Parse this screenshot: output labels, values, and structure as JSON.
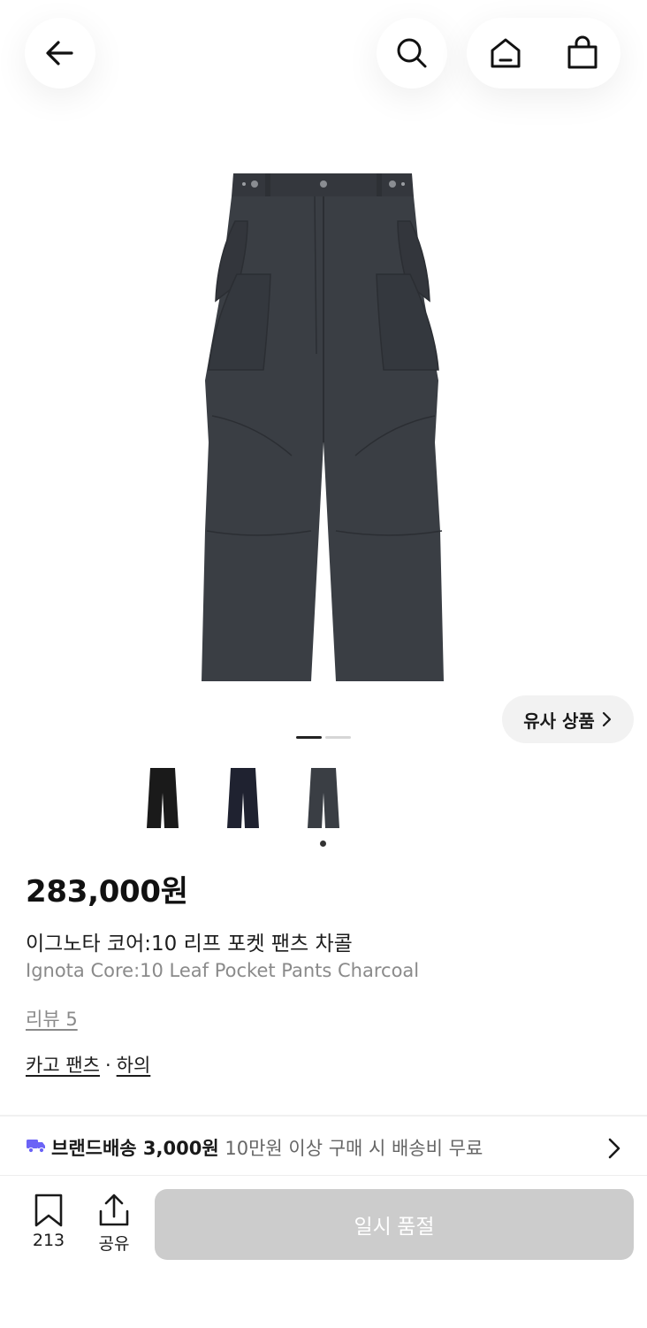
{
  "header": {
    "back_icon": "arrow-left-icon",
    "search_icon": "search-icon",
    "home_icon": "home-icon",
    "cart_icon": "shopping-bag-icon"
  },
  "gallery": {
    "similar_button_label": "유사 상품",
    "image_count": 2,
    "current_image": 1
  },
  "variants": {
    "items": [
      "black",
      "navy",
      "charcoal"
    ],
    "selected_index": 2
  },
  "product": {
    "price": "283,000원",
    "name_ko": "이그노타 코어:10 리프 포켓 팬츠 차콜",
    "name_en": "Ignota Core:10 Leaf Pocket Pants Charcoal",
    "review_label": "리뷰 5",
    "category": "카고 팬츠",
    "category_separator": "·",
    "parent_category": "하의"
  },
  "shipping": {
    "label": "브랜드배송 3,000원",
    "note": "10만원 이상 구매 시 배송비 무료"
  },
  "bottom_bar": {
    "bookmark_count": "213",
    "share_label": "공유",
    "action_label": "일시 품절"
  },
  "colors": {
    "accent_purple": "#6b63f6",
    "soldout_gray": "#cccccc",
    "pants_charcoal": "#3a3e44",
    "pants_black": "#1a1a1a",
    "pants_navy": "#1f2230"
  }
}
